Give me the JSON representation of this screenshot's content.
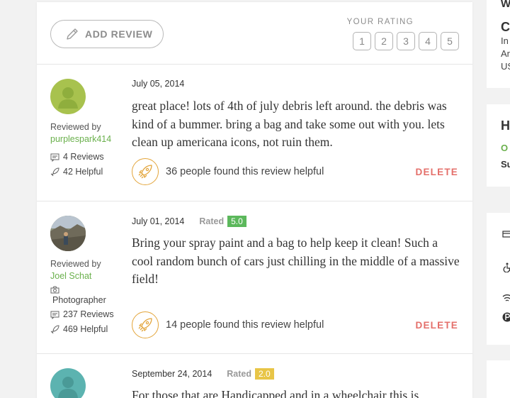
{
  "header": {
    "add_review_label": "ADD REVIEW",
    "your_rating_label": "YOUR RATING",
    "rating_options": [
      "1",
      "2",
      "3",
      "4",
      "5"
    ]
  },
  "reviews": [
    {
      "date": "July 05, 2014",
      "rated_label": "",
      "rating": "",
      "rating_color": "",
      "reviewed_by": "Reviewed by",
      "name": "purplespark414",
      "badge": "",
      "reviews_count": "4 Reviews",
      "helpful_count": "42 Helpful",
      "text": "great place! lots of 4th of july debris left around. the debris was kind of a bummer. bring a bag and take some out with you. lets clean up americana icons, not ruin them.",
      "helpful_text": "36 people found this review helpful",
      "delete_label": "DELETE"
    },
    {
      "date": "July 01, 2014",
      "rated_label": "Rated",
      "rating": "5.0",
      "rating_color": "#5cb85c",
      "reviewed_by": "Reviewed by",
      "name": "Joel Schat",
      "badge": "Photographer",
      "reviews_count": "237 Reviews",
      "helpful_count": "469 Helpful",
      "text": "Bring your spray paint and a bag to help keep it clean! Such a cool random bunch of cars just chilling in the middle of a massive field!",
      "helpful_text": "14 people found this review helpful",
      "delete_label": "DELETE"
    },
    {
      "date": "September 24, 2014",
      "rated_label": "Rated",
      "rating": "2.0",
      "rating_color": "#e8c547",
      "text": "For those that are Handicapped and in a wheelchair this is"
    }
  ],
  "side": {
    "card1": [
      "W",
      "C",
      "In",
      "Ar",
      "US"
    ],
    "card2": [
      "H",
      "O",
      "Su"
    ]
  },
  "colors": {
    "accent_green": "#6ab04c",
    "delete_red": "#e46f6a",
    "helpful_orange": "#e3a53b"
  }
}
